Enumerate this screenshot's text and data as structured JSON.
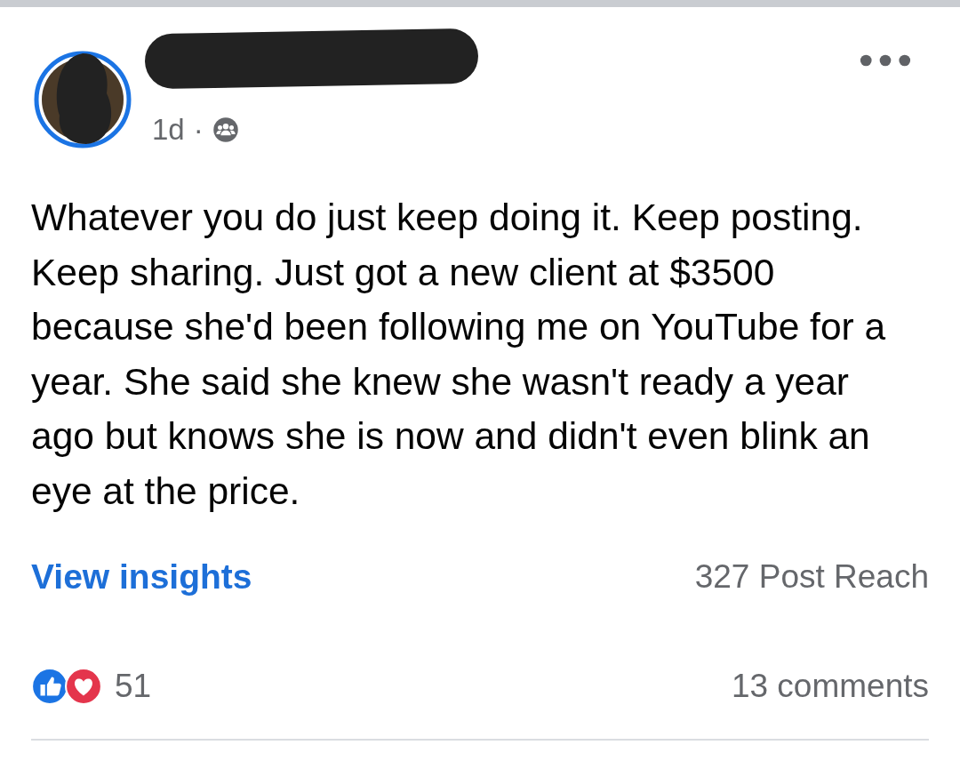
{
  "post": {
    "time": "1d",
    "separator": "·",
    "audience": {
      "kind": "group"
    },
    "text": "Whatever you do just keep doing it. Keep posting. Keep sharing. Just got a new client at $3500 because she'd been following me on YouTube for a year. She said she knew she wasn't ready a year ago but knows she is now and didn't even blink an eye at the price.",
    "insights_link": "View insights",
    "reach": "327 Post Reach",
    "reactions": [
      {
        "kind": "like"
      },
      {
        "kind": "love"
      }
    ],
    "reaction_count": "51",
    "comments": "13 comments"
  }
}
